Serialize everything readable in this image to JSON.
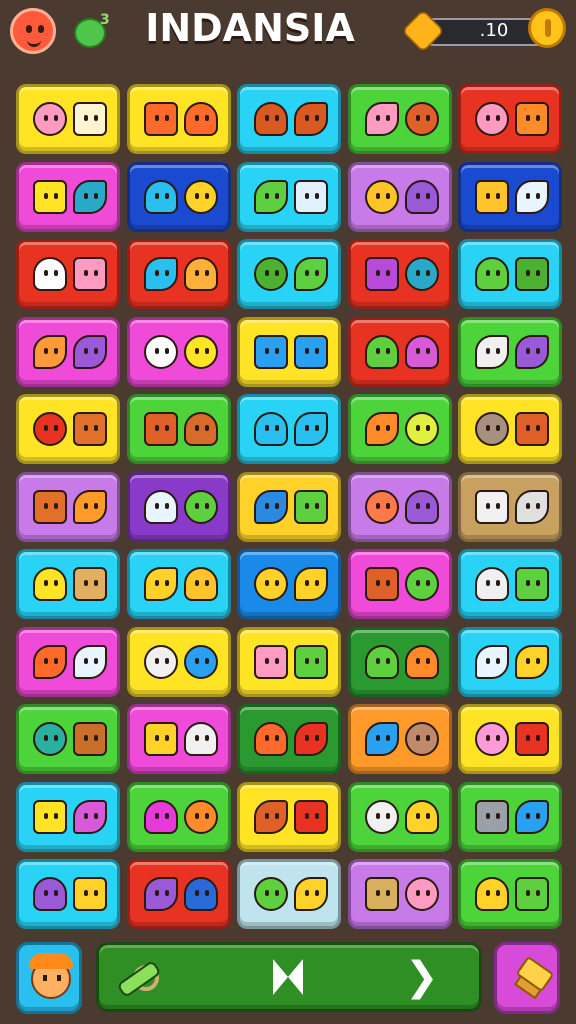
{
  "header": {
    "title": "INDANSIA",
    "pet_count": "3",
    "coins": ".10",
    "avatar_icon": "red-smiley-icon",
    "pet_icon": "green-pet-icon",
    "gem_icon": "gold-gem-icon",
    "coin_icon": "gold-coin-icon"
  },
  "board": {
    "rows": [
      {
        "tiles": [
          {
            "bg": "#ffe426",
            "a": "#ff9ac0",
            "b": "#fff4d0",
            "icon": "radish-and-house-icon"
          },
          {
            "bg": "#ffe426",
            "a": "#ff6a2a",
            "b": "#ff6a2a",
            "icon": "orange-blob-icon"
          },
          {
            "bg": "#29d3f5",
            "a": "#d85a20",
            "b": "#d85a20",
            "icon": "coconut-icon"
          },
          {
            "bg": "#4cd43a",
            "a": "#ff9ac0",
            "b": "#e0602a",
            "icon": "lollipop-and-creature-icon"
          },
          {
            "bg": "#e83222",
            "a": "#ff9ac0",
            "b": "#ff8a2a",
            "icon": "radish-and-creature-icon"
          }
        ]
      },
      {
        "tiles": [
          {
            "bg": "#f04ad8",
            "a": "#ffe426",
            "b": "#2aa8c8",
            "icon": "yellow-drop-icon"
          },
          {
            "bg": "#1a4ad0",
            "a": "#29c0f0",
            "b": "#ffd22a",
            "icon": "sun-and-leaf-icon"
          },
          {
            "bg": "#29d3f5",
            "a": "#5ed040",
            "b": "#e0f0ff",
            "icon": "leaf-and-feather-icon"
          },
          {
            "bg": "#c87ae8",
            "a": "#ffc42a",
            "b": "#9a5ad8",
            "icon": "drop-and-creature-icon"
          },
          {
            "bg": "#1a4ad0",
            "a": "#ffc42a",
            "b": "#e8f4ff",
            "icon": "cheese-and-ball-icon"
          }
        ]
      },
      {
        "tiles": [
          {
            "bg": "#e83222",
            "a": "#ffffff",
            "b": "#ff9ac0",
            "icon": "umbrella-and-pig-icon"
          },
          {
            "bg": "#e83222",
            "a": "#29c0f0",
            "b": "#ffb03a",
            "icon": "lollipop-and-carrot-icon"
          },
          {
            "bg": "#29d3f5",
            "a": "#4cb030",
            "b": "#5ed040",
            "icon": "palm-and-mushroom-icon"
          },
          {
            "bg": "#e83222",
            "a": "#b84ad8",
            "b": "#2aa8c8",
            "icon": "cup-and-bean-icon"
          },
          {
            "bg": "#29d3f5",
            "a": "#5ed040",
            "b": "#4cb030",
            "icon": "leaf-and-frog-icon"
          }
        ]
      },
      {
        "tiles": [
          {
            "bg": "#f04ad8",
            "a": "#ff9a3a",
            "b": "#9a5ad8",
            "icon": "camera-and-balloon-icon"
          },
          {
            "bg": "#f04ad8",
            "a": "#ffffff",
            "b": "#ffe426",
            "icon": "gem-and-star-icon"
          },
          {
            "bg": "#ffe426",
            "a": "#29a0f0",
            "b": "#29a0f0",
            "icon": "blue-fish-icon"
          },
          {
            "bg": "#e83222",
            "a": "#5ed040",
            "b": "#d85ad8",
            "icon": "palm-and-balloon-icon"
          },
          {
            "bg": "#4cd43a",
            "a": "#f0f0f0",
            "b": "#9a5ad8",
            "icon": "ghost-and-creature-icon"
          }
        ]
      },
      {
        "tiles": [
          {
            "bg": "#ffe426",
            "a": "#e83222",
            "b": "#e0702a",
            "icon": "cap-and-creature-icon"
          },
          {
            "bg": "#4cd43a",
            "a": "#e0602a",
            "b": "#d86a2a",
            "icon": "mushroom-and-egg-icon"
          },
          {
            "bg": "#29d3f5",
            "a": "#29c0f0",
            "b": "#29c0f0",
            "icon": "blue-fish-icon-2"
          },
          {
            "bg": "#4cd43a",
            "a": "#ff8a2a",
            "b": "#e0f040",
            "icon": "balloon-and-chick-icon"
          },
          {
            "bg": "#ffe426",
            "a": "#a89080",
            "b": "#e0602a",
            "icon": "rock-and-creature-icon"
          }
        ]
      },
      {
        "tiles": [
          {
            "bg": "#c87ae8",
            "a": "#e0702a",
            "b": "#ff9a2a",
            "icon": "face-and-carrot-icon"
          },
          {
            "bg": "#8a3ac8",
            "a": "#e8f4ff",
            "b": "#5ed040",
            "icon": "ghost-and-cactus-icon"
          },
          {
            "bg": "#ffd22a",
            "a": "#2a8ae0",
            "b": "#5ed040",
            "icon": "axe-and-bottle-icon"
          },
          {
            "bg": "#c87ae8",
            "a": "#ff7a4a",
            "b": "#9a5ad8",
            "icon": "carrot-and-monster-icon"
          },
          {
            "bg": "#c8a060",
            "a": "#f0f0f0",
            "b": "#e0e0e0",
            "icon": "palm-and-ball-icon"
          }
        ]
      },
      {
        "tiles": [
          {
            "bg": "#29d3f5",
            "a": "#ffe426",
            "b": "#e0b060",
            "icon": "chick-and-ring-icon"
          },
          {
            "bg": "#29d3f5",
            "a": "#ffd22a",
            "b": "#ffc42a",
            "icon": "swirl-and-star-icon"
          },
          {
            "bg": "#1a8ae8",
            "a": "#ffd22a",
            "b": "#ffd22a",
            "icon": "leaf-and-flower-icon"
          },
          {
            "bg": "#f04ad8",
            "a": "#e0602a",
            "b": "#5ed040",
            "icon": "carrot-and-leaf-icon"
          },
          {
            "bg": "#29d3f5",
            "a": "#f0f0f0",
            "b": "#5ed040",
            "icon": "ghost-and-turtle-icon"
          }
        ]
      },
      {
        "tiles": [
          {
            "bg": "#f04ad8",
            "a": "#ff6a2a",
            "b": "#e8f4ff",
            "icon": "flower-and-bulb-icon"
          },
          {
            "bg": "#ffe426",
            "a": "#f0f0f0",
            "b": "#29a0f0",
            "icon": "turnip-and-tree-icon"
          },
          {
            "bg": "#ffe426",
            "a": "#ff9ac0",
            "b": "#5ed040",
            "icon": "pig-and-frog-icon"
          },
          {
            "bg": "#2a9a30",
            "a": "#5ed040",
            "b": "#ff8a2a",
            "icon": "palm-and-bird-icon"
          },
          {
            "bg": "#29d3f5",
            "a": "#e8f4ff",
            "b": "#ffd22a",
            "icon": "ghost-and-chick-icon"
          }
        ]
      },
      {
        "tiles": [
          {
            "bg": "#4cd43a",
            "a": "#2ab0a0",
            "b": "#c8702a",
            "icon": "creature-and-potato-icon"
          },
          {
            "bg": "#f04ad8",
            "a": "#ffd22a",
            "b": "#f0f0f0",
            "icon": "bolt-and-check-icon"
          },
          {
            "bg": "#2a9a30",
            "a": "#ff6a2a",
            "b": "#e83222",
            "icon": "check-and-cherry-icon"
          },
          {
            "bg": "#ff9a2a",
            "a": "#29a0f0",
            "b": "#c08a6a",
            "icon": "fish-and-rock-icon"
          },
          {
            "bg": "#ffe426",
            "a": "#ff9ad8",
            "b": "#e83222",
            "icon": "tree-and-bear-icon"
          }
        ]
      },
      {
        "tiles": [
          {
            "bg": "#29d3f5",
            "a": "#ffe426",
            "b": "#d85ad8",
            "icon": "chick-and-pin-icon"
          },
          {
            "bg": "#4cd43a",
            "a": "#e83ad8",
            "b": "#ff8a2a",
            "icon": "lollipop-and-leaf-icon"
          },
          {
            "bg": "#ffe426",
            "a": "#e0602a",
            "b": "#e83222",
            "icon": "crossed-swords-icon"
          },
          {
            "bg": "#4cd43a",
            "a": "#f0f0f0",
            "b": "#ffd22a",
            "icon": "ghost-and-carrot-icon"
          },
          {
            "bg": "#4cd43a",
            "a": "#9aa0a8",
            "b": "#29a0f0",
            "icon": "arrow-and-shield-icon"
          }
        ]
      },
      {
        "tiles": [
          {
            "bg": "#29d3f5",
            "a": "#9a5ad8",
            "b": "#ffd22a",
            "icon": "key-and-frame-icon"
          },
          {
            "bg": "#e83222",
            "a": "#9a5ad8",
            "b": "#2a6ad8",
            "icon": "egg-and-boot-icon"
          },
          {
            "bg": "#bfe4ee",
            "a": "#5ed040",
            "b": "#ffd22a",
            "icon": "cactus-and-chick-icon"
          },
          {
            "bg": "#c87ae8",
            "a": "#d8b060",
            "b": "#ff9ac0",
            "icon": "barrel-and-pig-icon"
          },
          {
            "bg": "#4cd43a",
            "a": "#ffd22a",
            "b": "#5ed040",
            "icon": "picture-and-frog-icon"
          }
        ]
      }
    ]
  },
  "footer": {
    "left_icon": "orange-hair-face-icon",
    "bar_left_icon": "star-and-ring-icon",
    "bar_center_icon": "bowtie-icon",
    "bar_right_icon": "next-chevron-icon",
    "chevron_glyph": "❯",
    "right_icon": "hammer-icon",
    "left_btn_color": "#29c0f0",
    "right_btn_color": "#d84ad8"
  }
}
